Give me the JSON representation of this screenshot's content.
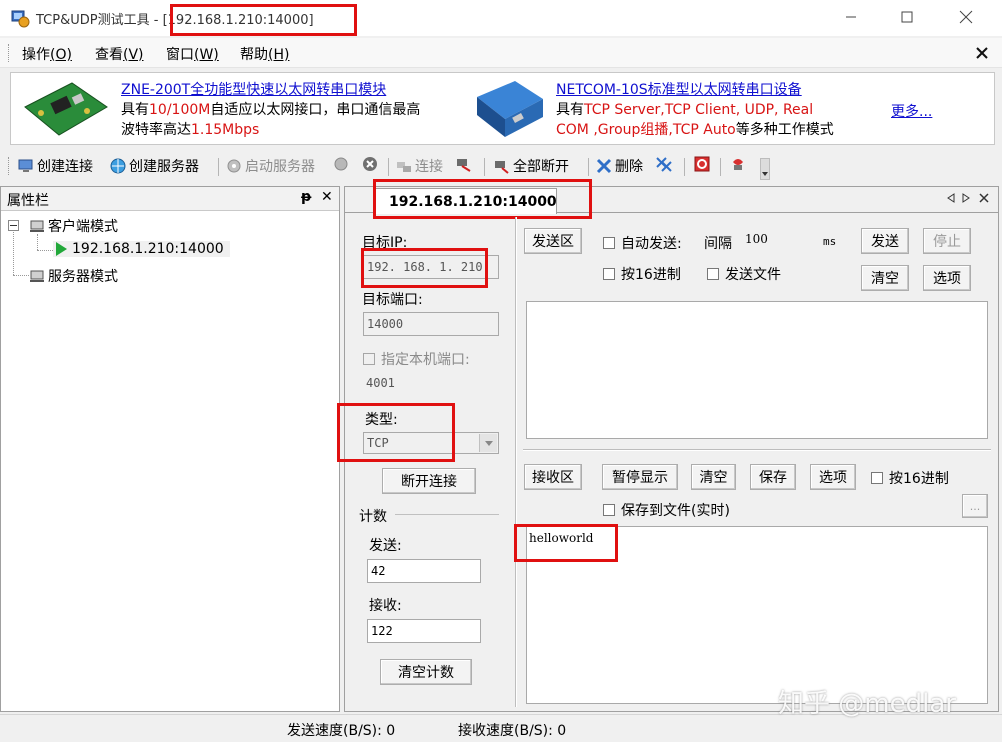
{
  "window": {
    "title": "TCP&UDP测试工具",
    "title_sep": " - ",
    "connection": "[192.168.1.210:14000]"
  },
  "menu": [
    {
      "label": "操作",
      "key": "(O)"
    },
    {
      "label": "查看",
      "key": "(V)"
    },
    {
      "label": "窗口",
      "key": "(W)"
    },
    {
      "label": "帮助",
      "key": "(H)"
    }
  ],
  "ad": {
    "left_title": "ZNE-200T全功能型快速以太网转串口模块",
    "left_l2a": "具有",
    "left_l2b": "10/100M",
    "left_l2c": "自适应以太网接口，串口通信最高",
    "left_l3a": "波特率高达",
    "left_l3b": "1.15Mbps",
    "right_title": "NETCOM-10S标准型以太网转串口设备",
    "right_l2a": "具有",
    "right_l2b": "TCP Server,TCP Client, UDP, Real",
    "right_l3a": "COM ,Group组播,TCP Auto",
    "right_l3b": "等多种工作模式",
    "more": "更多..."
  },
  "toolbar": {
    "create_conn": "创建连接",
    "create_server": "创建服务器",
    "start_server": "启动服务器",
    "connect": "连接",
    "disconnect_all": "全部断开",
    "delete": "删除"
  },
  "left": {
    "header": "属性栏",
    "pin": "ᵽ",
    "close": "✕",
    "tree": {
      "client": "客户端模式",
      "conn": "192.168.1.210:14000",
      "server": "服务器模式"
    }
  },
  "tab": {
    "label": "192.168.1.210:14000"
  },
  "config": {
    "target_ip_label": "目标IP:",
    "target_ip": "192. 168. 1. 210",
    "target_port_label": "目标端口:",
    "target_port": "14000",
    "local_port_label": "指定本机端口:",
    "local_port": "4001",
    "type_label": "类型:",
    "type": "TCP",
    "disconnect_btn": "断开连接",
    "counter_label": "计数",
    "send_label": "发送:",
    "send_count": "42",
    "recv_label": "接收:",
    "recv_count": "122",
    "clear_count_btn": "清空计数"
  },
  "send": {
    "area_btn": "发送区",
    "auto_send": "自动发送:",
    "interval_label": "间隔",
    "interval": "100",
    "unit": "ms",
    "send_btn": "发送",
    "stop_btn": "停止",
    "hex": "按16进制",
    "send_file": "发送文件",
    "clear_btn": "清空",
    "options_btn": "选项"
  },
  "recv": {
    "area_btn": "接收区",
    "pause_btn": "暂停显示",
    "clear_btn": "清空",
    "save_btn": "保存",
    "options_btn": "选项",
    "hex": "按16进制",
    "save_file": "保存到文件(实时)",
    "browse": "...",
    "content": "helloworld"
  },
  "status": {
    "send_speed": "发送速度(B/S): 0",
    "recv_speed": "接收速度(B/S): 0"
  },
  "watermark": "知乎 @medlar",
  "colors": {
    "annotation_red": "#e01010",
    "link_blue": "#1010d0",
    "highlight_red": "#d81414"
  }
}
